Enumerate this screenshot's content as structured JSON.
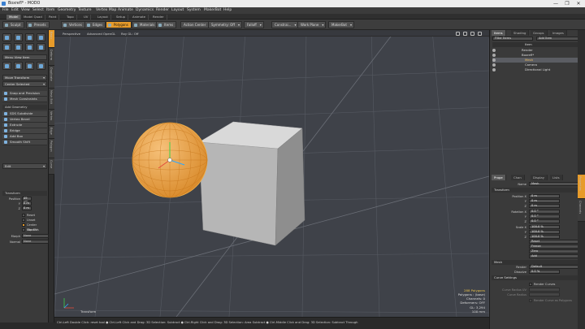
{
  "window": {
    "title": "Boxrefl* - MODO",
    "controls": [
      "—",
      "❐",
      "✕"
    ]
  },
  "menubar": [
    "File",
    "Edit",
    "View",
    "Select",
    "Item",
    "Geometry",
    "Texture",
    "Vertex Map",
    "Animate",
    "Dynamics",
    "Render",
    "Layout",
    "System",
    "MakerBot",
    "Help"
  ],
  "layout_tabs": [
    "Model",
    "Model Quad",
    "Paint",
    "Topo",
    "UV",
    "Layout",
    "Setup",
    "Animate",
    "Render"
  ],
  "toolbar": {
    "left": [
      "Sculpt",
      "Presets"
    ],
    "modes": [
      "Vertices",
      "Edges",
      "Polygons",
      "Materials",
      "Items"
    ],
    "active_mode": "Polygons",
    "dropdowns": [
      "Action Center",
      "Symmetry: Off",
      "Falloff",
      "Constrai...",
      "Work Plane",
      "MakerBot"
    ]
  },
  "left_vtabs": [
    "Basic",
    "Deform",
    "Duplicate",
    "Mesh Edit",
    "Vertex",
    "Edge",
    "Polygon",
    "Curve"
  ],
  "left_panel": {
    "view_menu": "Menu View Item",
    "move_transform": "Move Transform",
    "center_selected": "Center Selected",
    "snap_precision": "Snap and Precision",
    "mesh_constraints": "Mesh Constraints",
    "add_geometry": "Add Geometry",
    "tools": [
      "SDS Subdivide",
      "Vertex Bevel",
      "Extrude",
      "Bridge",
      "Add Box",
      "Smooth Shift",
      "Edit"
    ],
    "tool_shortcuts": [
      "Shift+D",
      "",
      "Shift+X",
      "",
      "",
      "",
      ""
    ],
    "dropdown_edit": "Edit",
    "transform_header": "Transform",
    "position_label": "Position",
    "axes": [
      "X",
      "Y",
      "Z"
    ],
    "pos_values": [
      "49 cm",
      "0 m",
      "0 m"
    ],
    "checks": [
      "Reset",
      "Unset",
      "Center Handle",
      "Slip UVs"
    ],
    "morph_label": "Morph",
    "morph_value": "None",
    "normal_label": "Normal",
    "normal_value": "None"
  },
  "viewport": {
    "tabs": [
      "Perspective",
      "Advanced OpenGL",
      "Ray GL: Off"
    ],
    "label_bottom": "Transform",
    "stats": {
      "polygons_sel": "288 Polygons",
      "polygons": "Polygons : (base)",
      "channels": "Channels: 0",
      "deformers": "Deformers: OFF",
      "gl": "GL: 3,294",
      "scale": "100 mm"
    }
  },
  "statusbar": "Ctrl-Left Double Click: reset tool ● Ctrl-Left Click and Drag: 3D Selection: Subtract ● Ctrl-Right Click and Drag: 3D Selection: Area Subtract ● Ctrl-Middle Click and Drag: 3D Selection: Subtract Through",
  "right_top": {
    "tabs": [
      "Items",
      "Shading",
      "Groups",
      "Images"
    ],
    "filter": "Filter Items",
    "add_item": "Add Item",
    "cols": "Item",
    "items": [
      "Render",
      "Boxrefl*",
      "Mesh",
      "Camera",
      "Directional Light"
    ]
  },
  "right_bottom": {
    "tabs": [
      "Prope",
      "Chan",
      "Display",
      "Lists"
    ],
    "name_label": "Name",
    "name_value": "Mesh",
    "transform": "Transform",
    "position_label": "Position X",
    "rotation_label": "Rotation X",
    "scale_label": "Scale X",
    "axes": [
      "X",
      "Y",
      "Z"
    ],
    "position": [
      "0 m",
      "0 m",
      "0 m"
    ],
    "rotation": [
      "0.0 °",
      "0.0 °",
      "0.0 °"
    ],
    "scale": [
      "100.0 %",
      "100.0 %",
      "100.0 %"
    ],
    "buttons": [
      "Reset",
      "Freeze",
      "Zero",
      "Add"
    ],
    "mesh": "Mesh",
    "render_label": "Render",
    "render_value": "Default",
    "dissolve_label": "Dissolve",
    "dissolve_value": "0.0 %",
    "curve": "Curve Settings",
    "render_curves": "Render Curves",
    "curve_radius": "Curve Radius",
    "curve_radius_uv": "Curve Radius UV",
    "render_as_polys": "Render Curve as Polygons"
  },
  "right_vtabs": [
    "Properties",
    "Channels"
  ]
}
